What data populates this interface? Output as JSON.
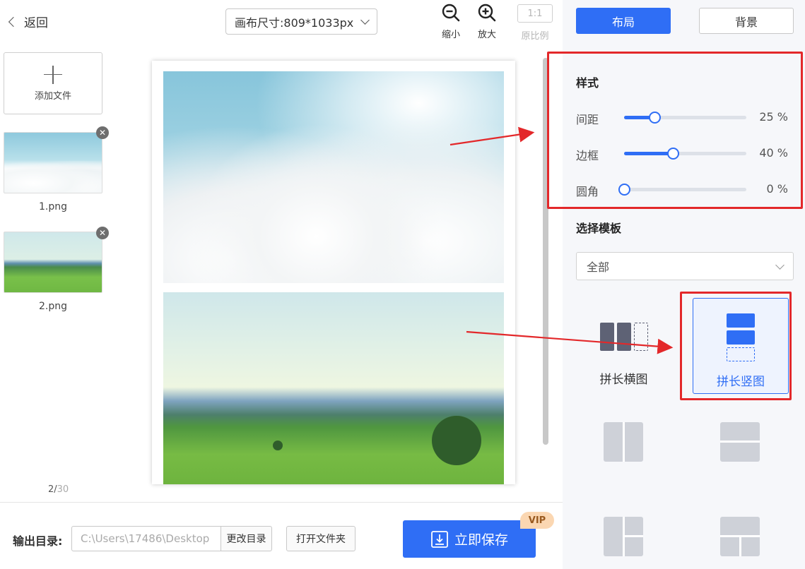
{
  "header": {
    "back_label": "返回",
    "canvas_size": "画布尺寸:809*1033px",
    "zoom_out_label": "缩小",
    "zoom_in_label": "放大",
    "ratio_button": "1:1",
    "ratio_label": "原比例"
  },
  "files": {
    "add_label": "添加文件",
    "items": [
      {
        "name": "1.png"
      },
      {
        "name": "2.png"
      }
    ],
    "page_current": "2/",
    "page_total": "30"
  },
  "bottom": {
    "output_label": "输出目录:",
    "output_path": "C:\\Users\\17486\\Desktop",
    "change_dir_label": "更改目录",
    "open_folder_label": "打开文件夹",
    "save_label": "立即保存",
    "vip_label": "VIP"
  },
  "right_panel": {
    "tabs": [
      {
        "label": "布局",
        "active": true
      },
      {
        "label": "背景",
        "active": false
      }
    ],
    "style_title": "样式",
    "sliders": [
      {
        "label": "间距",
        "value": 25,
        "unit": "%"
      },
      {
        "label": "边框",
        "value": 40,
        "unit": "%"
      },
      {
        "label": "圆角",
        "value": 0,
        "unit": "%"
      }
    ],
    "template_title": "选择模板",
    "template_filter": "全部",
    "templates": [
      {
        "label": "拼长横图",
        "selected": false
      },
      {
        "label": "拼长竖图",
        "selected": true
      }
    ]
  },
  "colors": {
    "accent": "#2f6ef5",
    "highlight": "#e3282a",
    "icon_gray": "#ced1d8"
  }
}
